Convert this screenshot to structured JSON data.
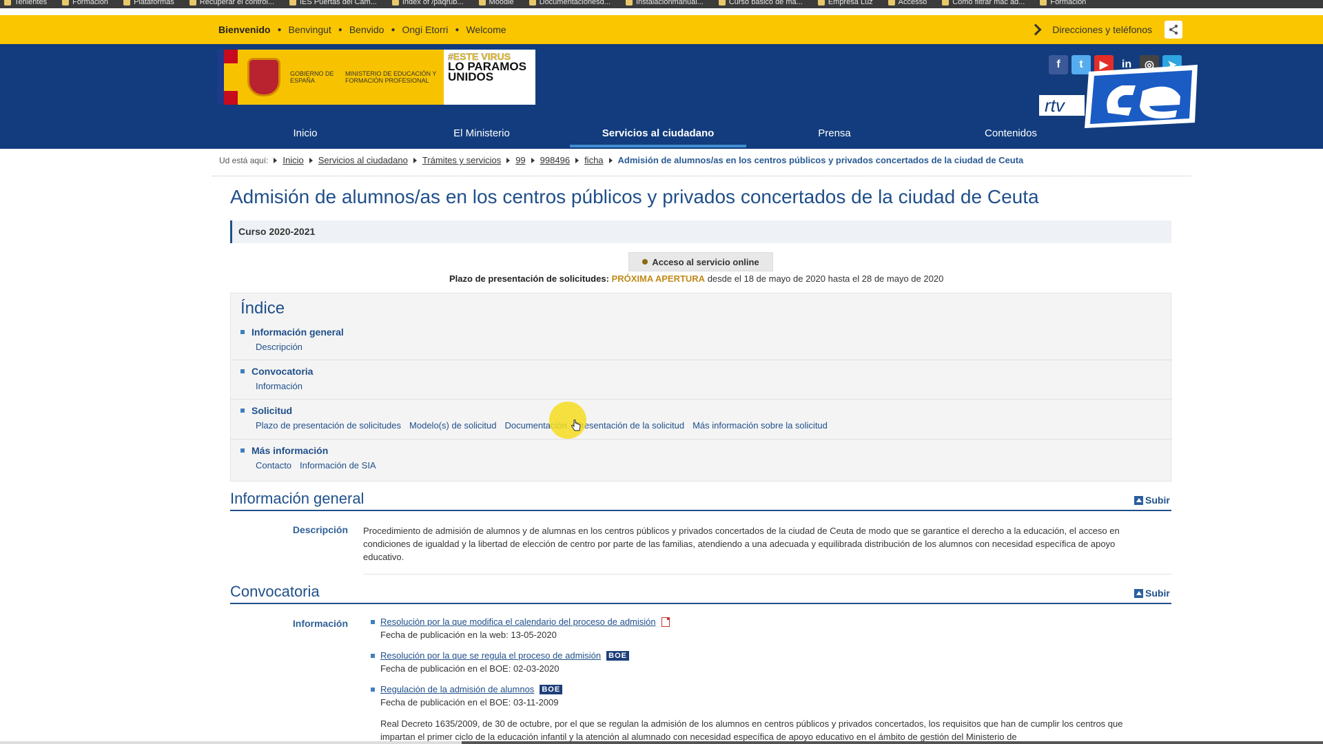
{
  "bookmarks": [
    {
      "label": "Tenientes"
    },
    {
      "label": "Formación"
    },
    {
      "label": "Plataformas"
    },
    {
      "label": "Recuperar el control..."
    },
    {
      "label": "IES Puertas del Cam..."
    },
    {
      "label": "Index of /paqrub..."
    },
    {
      "label": "Moodle"
    },
    {
      "label": "Documentacionesd..."
    },
    {
      "label": "Instalacionmanual..."
    },
    {
      "label": "Curso básico de ma..."
    },
    {
      "label": "Empresa Luz"
    },
    {
      "label": "Accesso"
    },
    {
      "label": "Como filtrar mac ad..."
    },
    {
      "label": "Formación"
    }
  ],
  "langbar": {
    "languages": [
      "Bienvenido",
      "Benvingut",
      "Benvido",
      "Ongi Etorri",
      "Welcome"
    ],
    "contact_label": "Direcciones y teléfonos"
  },
  "logo": {
    "gob_text": "Gobierno de España",
    "ministry_text": "Ministerio de Educación y Formación Profesional",
    "campaign_hash": "#ESTE VIRUS",
    "campaign_main": "LO PARAMOS UNIDOS"
  },
  "socials": [
    {
      "name": "facebook-icon",
      "glyph": "f",
      "color": "#3b5998"
    },
    {
      "name": "twitter-icon",
      "glyph": "t",
      "color": "#55acee"
    },
    {
      "name": "youtube-icon",
      "glyph": "▶",
      "color": "#e52d27"
    },
    {
      "name": "linkedin-icon",
      "glyph": "in",
      "color": "#123c7d"
    },
    {
      "name": "instagram-icon",
      "glyph": "◎",
      "color": "#444444"
    },
    {
      "name": "telegram-icon",
      "glyph": "➤",
      "color": "#2ca5e0"
    }
  ],
  "nav": {
    "items": [
      "Inicio",
      "El Ministerio",
      "Servicios al ciudadano",
      "Prensa",
      "Contenidos"
    ],
    "active_index": 2
  },
  "breadcrumb": {
    "lead": "Ud está aquí:",
    "links": [
      "Inicio",
      "Servicios al ciudadano",
      "Trámites y servicios",
      "99",
      "998496",
      "ficha"
    ],
    "current": "Admisión de alumnos/as en los centros públicos y privados concertados de la ciudad de Ceuta"
  },
  "page": {
    "title": "Admisión de alumnos/as en los centros públicos y privados concertados de la ciudad de Ceuta",
    "course": "Curso 2020-2021",
    "online_button": "Acceso al servicio online",
    "plazo_label": "Plazo de presentación de solicitudes:",
    "plazo_status": "PRÓXIMA APERTURA",
    "plazo_range": "desde el 18 de mayo de 2020 hasta el 28 de mayo de 2020"
  },
  "indice": {
    "title": "Índice",
    "groups": [
      {
        "title": "Información general",
        "links": [
          "Descripción"
        ]
      },
      {
        "title": "Convocatoria",
        "links": [
          "Información"
        ]
      },
      {
        "title": "Solicitud",
        "links": [
          "Plazo de presentación de solicitudes",
          "Modelo(s) de solicitud",
          "Documentación",
          "Presentación de la solicitud",
          "Más información sobre la solicitud"
        ]
      },
      {
        "title": "Más información",
        "links": [
          "Contacto",
          "Información de SIA"
        ]
      }
    ]
  },
  "info_general": {
    "title": "Información general",
    "subir": "Subir",
    "desc_label": "Descripción",
    "desc_text": "Procedimiento de admisión de alumnos y de alumnas en los centros públicos y privados concertados de la ciudad de Ceuta de modo que se garantice el derecho a la educación, el acceso en condiciones de igualdad y la libertad de elección de centro por parte de las familias, atendiendo a una adecuada y equilibrada distribución de los alumnos con necesidad específica de apoyo educativo."
  },
  "convocatoria": {
    "title": "Convocatoria",
    "subir": "Subir",
    "label": "Información",
    "items": [
      {
        "link": "Resolución por la que modifica el calendario del proceso de admisión",
        "badge": "pdf",
        "date": "Fecha de publicación en la web: 13-05-2020"
      },
      {
        "link": "Resolución por la que se regula el proceso de admisión",
        "badge": "BOE",
        "date": "Fecha de publicación en el BOE: 02-03-2020"
      },
      {
        "link": "Regulación de la admisión de alumnos",
        "badge": "BOE",
        "date": "Fecha de publicación en el BOE: 03-11-2009"
      }
    ],
    "long_text": "Real Decreto 1635/2009, de 30 de octubre, por el que se regulan la admisión de los alumnos en centros públicos y privados concertados, los requisitos que han de cumplir los centros que impartan el primer ciclo de la educación infantil y la atención al alumnado con necesidad específica de apoyo educativo en el ámbito de gestión del Ministerio de"
  }
}
